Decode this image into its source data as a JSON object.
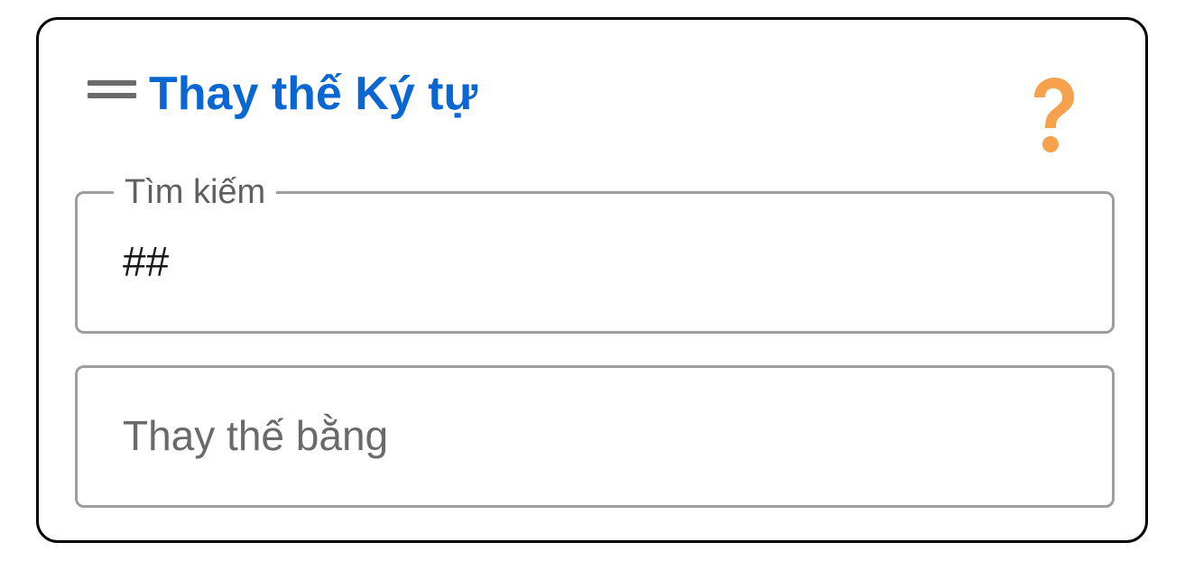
{
  "dialog": {
    "title": "Thay thế Ký tự",
    "help_icon": "question-mark-icon",
    "drag_icon": "drag-handle-icon",
    "title_color": "#0a66d1",
    "help_color": "#f6a24d"
  },
  "search_field": {
    "label": "Tìm kiếm",
    "value": "##"
  },
  "replace_field": {
    "placeholder": "Thay thế bằng",
    "value": ""
  }
}
